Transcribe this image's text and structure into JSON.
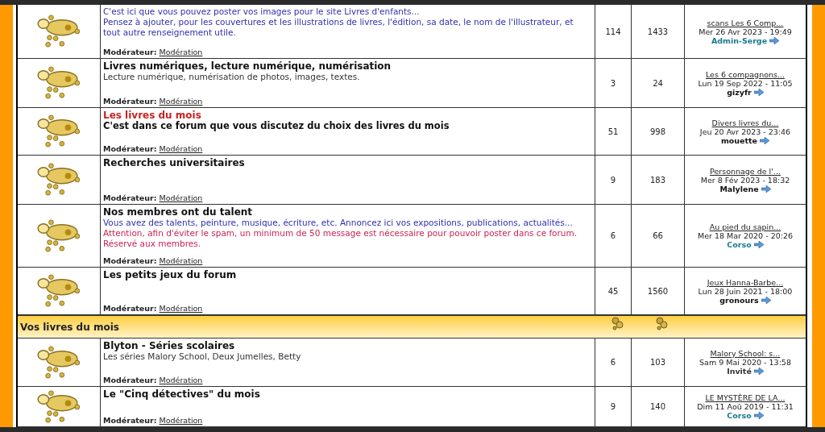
{
  "rows": [
    {
      "kind": "forum",
      "lines": [
        {
          "text": "C'est ici que vous pouvez poster vos images pour le site Livres d'enfants...",
          "color": "#3030b0"
        },
        {
          "text": "Pensez à ajouter, pour les couvertures et les illustrations de livres, l'édition, sa date, le nom de l'illustrateur, et tout autre renseignement utile.",
          "color": "#3030b0"
        }
      ],
      "moderator_label": "Modérateur:",
      "moderator": "Modération",
      "topics": "114",
      "posts": "1433",
      "last_topic": "scans Les 6 Comp...",
      "last_date": "Mer 26 Avr 2023 - 19:49",
      "author": {
        "name": "Admin-Serge",
        "color": "#1a7a90"
      }
    },
    {
      "kind": "forum",
      "title": {
        "text": "Livres numériques, lecture numérique, numérisation",
        "color": "#111111"
      },
      "lines": [
        {
          "text": "Lecture numérique, numérisation de photos, images, textes.",
          "color": "#333333"
        }
      ],
      "moderator_label": "Modérateur:",
      "moderator": "Modération",
      "topics": "3",
      "posts": "24",
      "last_topic": "Les 6 compagnons...",
      "last_date": "Lun 19 Sep 2022 - 11:05",
      "author": {
        "name": "gizyfr",
        "color": "#111111"
      }
    },
    {
      "kind": "forum",
      "title": {
        "text": "Les livres du mois",
        "color": "#cc2222"
      },
      "subtitle": "C'est dans ce forum que vous discutez du choix des livres du mois",
      "lines": [],
      "moderator_label": "Modérateur:",
      "moderator": "Modération",
      "topics": "51",
      "posts": "998",
      "last_topic": "Divers livres du...",
      "last_date": "Jeu 20 Avr 2023 - 23:46",
      "author": {
        "name": "mouette",
        "color": "#111111"
      }
    },
    {
      "kind": "forum",
      "title": {
        "text": "Recherches universitaires",
        "color": "#111111"
      },
      "lines": [],
      "moderator_label": "Modérateur:",
      "moderator": "Modération",
      "topics": "9",
      "posts": "183",
      "last_topic": "Personnage de l'...",
      "last_date": "Mer 8 Fév 2023 - 18:32",
      "author": {
        "name": "Malylene",
        "color": "#111111"
      }
    },
    {
      "kind": "forum",
      "title": {
        "text": "Nos membres ont du talent",
        "color": "#111111"
      },
      "lines": [
        {
          "text": "Vous avez des talents, peinture, musique, écriture, etc. Annoncez ici vos expositions, publications, actualités...",
          "color": "#3030b0"
        },
        {
          "text": "Attention, afin d'éviter le spam, un minimum de 50 message est nécessaire pour pouvoir poster dans ce forum. Réservé aux membres.",
          "color": "#cc2255"
        }
      ],
      "moderator_label": "Modérateur:",
      "moderator": "Modération",
      "topics": "6",
      "posts": "66",
      "last_topic": "Au pied du sapin...",
      "last_date": "Mer 18 Mar 2020 - 20:26",
      "author": {
        "name": "Corso",
        "color": "#1a7a90"
      }
    },
    {
      "kind": "forum",
      "title": {
        "text": "Les petits jeux du forum",
        "color": "#111111"
      },
      "lines": [],
      "moderator_label": "Modérateur:",
      "moderator": "Modération",
      "topics": "45",
      "posts": "1560",
      "last_topic": "Jeux Hanna-Barbe...",
      "last_date": "Lun 28 Juin 2021 - 18:00",
      "author": {
        "name": "gronours",
        "color": "#111111"
      }
    },
    {
      "kind": "category",
      "title": {
        "text": "Vos livres du mois"
      }
    },
    {
      "kind": "forum",
      "title": {
        "text": "Blyton - Séries scolaires",
        "color": "#111111"
      },
      "lines": [
        {
          "text": "Les séries Malory School, Deux Jumelles, Betty",
          "color": "#333333"
        }
      ],
      "moderator_label": "Modérateur:",
      "moderator": "Modération",
      "topics": "6",
      "posts": "103",
      "last_topic": "Malory School: s...",
      "last_date": "Sam 9 Mai 2020 - 13:58",
      "author": {
        "name": "Invité",
        "color": "#333333"
      }
    },
    {
      "kind": "forum",
      "title": {
        "text": "Le \"Cinq détectives\" du mois",
        "color": "#111111"
      },
      "lines": [],
      "moderator_label": "Modérateur:",
      "moderator": "Modération",
      "topics": "9",
      "posts": "140",
      "last_topic": "LE MYSTÈRE DE LA...",
      "last_date": "Dim 11 Aoû 2019 - 11:31",
      "author": {
        "name": "Corso",
        "color": "#1a7a90"
      }
    }
  ]
}
